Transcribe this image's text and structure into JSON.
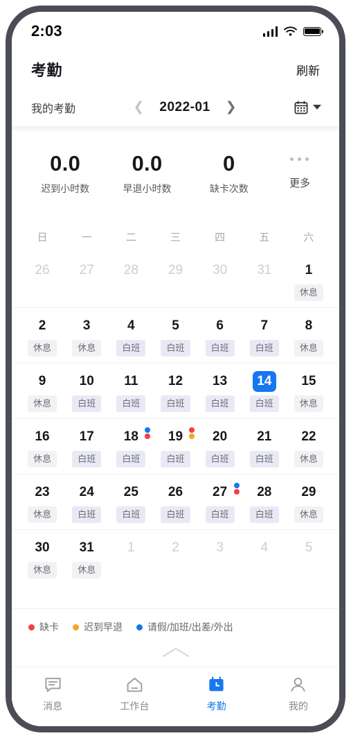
{
  "status_bar": {
    "time": "2:03",
    "signal_icon": "signal-bars-icon",
    "wifi_icon": "wifi-icon",
    "battery_icon": "battery-full-icon"
  },
  "header": {
    "title": "考勤",
    "refresh_label": "刷新"
  },
  "month_bar": {
    "mine_label": "我的考勤",
    "prev_icon": "chevron-left-icon",
    "month": "2022-01",
    "next_icon": "chevron-right-icon",
    "calendar_icon": "calendar-icon",
    "caret_icon": "chevron-down-icon"
  },
  "stats": {
    "items": [
      {
        "value": "0.0",
        "label": "迟到小时数"
      },
      {
        "value": "0.0",
        "label": "早退小时数"
      },
      {
        "value": "0",
        "label": "缺卡次数"
      }
    ],
    "more_label": "更多",
    "more_icon": "ellipsis-icon"
  },
  "calendar": {
    "weekdays": [
      "日",
      "一",
      "二",
      "三",
      "四",
      "五",
      "六"
    ],
    "rows": [
      [
        {
          "day": "26",
          "muted": true,
          "tag": ""
        },
        {
          "day": "27",
          "muted": true,
          "tag": ""
        },
        {
          "day": "28",
          "muted": true,
          "tag": ""
        },
        {
          "day": "29",
          "muted": true,
          "tag": ""
        },
        {
          "day": "30",
          "muted": true,
          "tag": ""
        },
        {
          "day": "31",
          "muted": true,
          "tag": ""
        },
        {
          "day": "1",
          "muted": false,
          "tag": "休息",
          "tag_type": "rest"
        }
      ],
      [
        {
          "day": "2",
          "tag": "休息",
          "tag_type": "rest"
        },
        {
          "day": "3",
          "tag": "休息",
          "tag_type": "rest"
        },
        {
          "day": "4",
          "tag": "白班",
          "tag_type": "day"
        },
        {
          "day": "5",
          "tag": "白班",
          "tag_type": "day"
        },
        {
          "day": "6",
          "tag": "白班",
          "tag_type": "day"
        },
        {
          "day": "7",
          "tag": "白班",
          "tag_type": "day"
        },
        {
          "day": "8",
          "tag": "休息",
          "tag_type": "rest"
        }
      ],
      [
        {
          "day": "9",
          "tag": "休息",
          "tag_type": "rest"
        },
        {
          "day": "10",
          "tag": "白班",
          "tag_type": "day"
        },
        {
          "day": "11",
          "tag": "白班",
          "tag_type": "day"
        },
        {
          "day": "12",
          "tag": "白班",
          "tag_type": "day"
        },
        {
          "day": "13",
          "tag": "白班",
          "tag_type": "day"
        },
        {
          "day": "14",
          "tag": "白班",
          "tag_type": "day",
          "selected": true
        },
        {
          "day": "15",
          "tag": "休息",
          "tag_type": "rest"
        }
      ],
      [
        {
          "day": "16",
          "tag": "休息",
          "tag_type": "rest"
        },
        {
          "day": "17",
          "tag": "白班",
          "tag_type": "day"
        },
        {
          "day": "18",
          "tag": "白班",
          "tag_type": "day",
          "dots": [
            "blue",
            "red"
          ]
        },
        {
          "day": "19",
          "tag": "白班",
          "tag_type": "day",
          "dots": [
            "red",
            "orange"
          ]
        },
        {
          "day": "20",
          "tag": "白班",
          "tag_type": "day"
        },
        {
          "day": "21",
          "tag": "白班",
          "tag_type": "day"
        },
        {
          "day": "22",
          "tag": "休息",
          "tag_type": "rest"
        }
      ],
      [
        {
          "day": "23",
          "tag": "休息",
          "tag_type": "rest"
        },
        {
          "day": "24",
          "tag": "白班",
          "tag_type": "day"
        },
        {
          "day": "25",
          "tag": "白班",
          "tag_type": "day"
        },
        {
          "day": "26",
          "tag": "白班",
          "tag_type": "day"
        },
        {
          "day": "27",
          "tag": "白班",
          "tag_type": "day",
          "dots": [
            "blue",
            "red"
          ]
        },
        {
          "day": "28",
          "tag": "白班",
          "tag_type": "day"
        },
        {
          "day": "29",
          "tag": "休息",
          "tag_type": "rest"
        }
      ],
      [
        {
          "day": "30",
          "tag": "休息",
          "tag_type": "rest"
        },
        {
          "day": "31",
          "tag": "休息",
          "tag_type": "rest"
        },
        {
          "day": "1",
          "muted": true,
          "tag": ""
        },
        {
          "day": "2",
          "muted": true,
          "tag": ""
        },
        {
          "day": "3",
          "muted": true,
          "tag": ""
        },
        {
          "day": "4",
          "muted": true,
          "tag": ""
        },
        {
          "day": "5",
          "muted": true,
          "tag": ""
        }
      ]
    ]
  },
  "legend": {
    "items": [
      {
        "label": "缺卡",
        "color": "#f53f3f"
      },
      {
        "label": "迟到早退",
        "color": "#f5a623"
      },
      {
        "label": "请假/加班/出差/外出",
        "color": "#1677f0"
      }
    ],
    "collapse_icon": "chevron-up-icon"
  },
  "tabbar": {
    "items": [
      {
        "label": "消息",
        "icon": "message-icon",
        "active": false
      },
      {
        "label": "工作台",
        "icon": "home-icon",
        "active": false
      },
      {
        "label": "考勤",
        "icon": "attendance-calendar-icon",
        "active": true
      },
      {
        "label": "我的",
        "icon": "person-icon",
        "active": false
      }
    ]
  },
  "colors": {
    "accent": "#1677f0",
    "red": "#f53f3f",
    "orange": "#f5a623",
    "tag_rest_bg": "#f2f2f4",
    "tag_day_bg": "#e9e9f6",
    "bezel": "#4a4d55"
  }
}
